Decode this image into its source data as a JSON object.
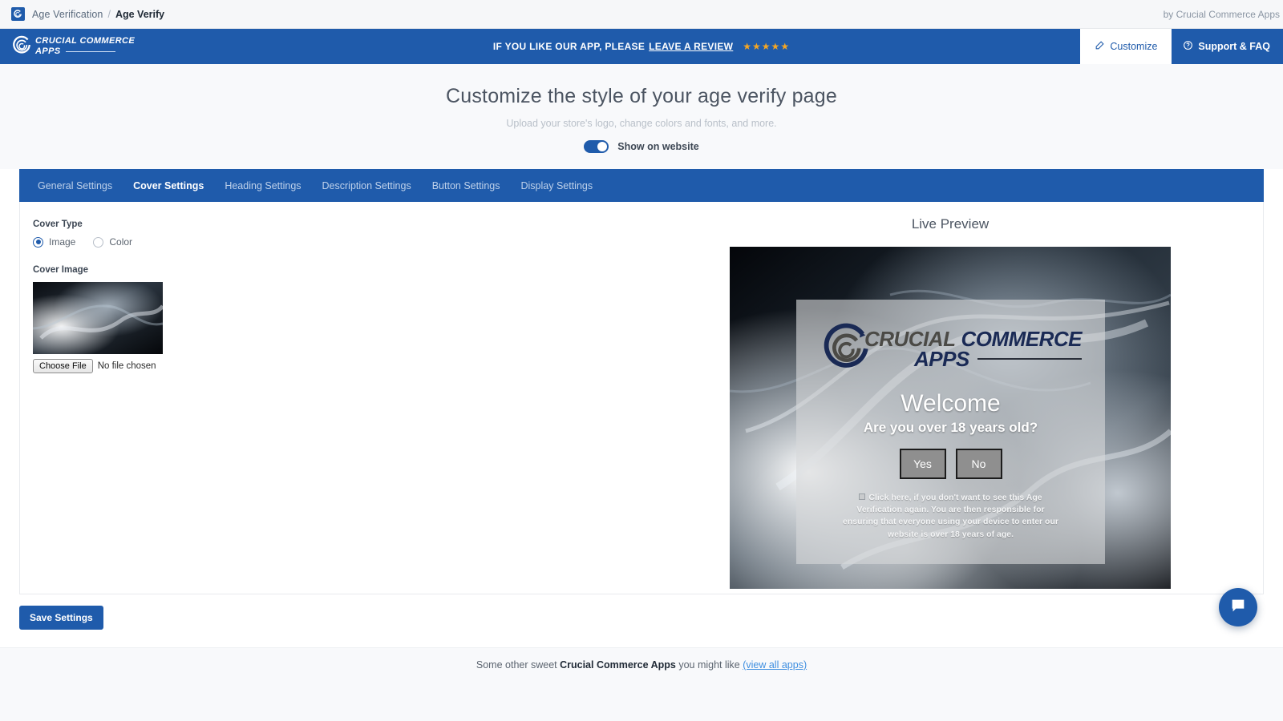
{
  "breadcrumb": {
    "app_icon": "app-logo-icon",
    "parent": "Age Verification",
    "separator": "/",
    "current": "Age Verify",
    "by_line": "by Crucial Commerce Apps"
  },
  "topnav": {
    "brand_line1": "CRUCIAL COMMERCE",
    "brand_line2": "APPS",
    "review_text": "IF YOU LIKE OUR APP, PLEASE",
    "review_link": "LEAVE A REVIEW",
    "stars": "★★★★★",
    "customize_label": "Customize",
    "support_label": "Support & FAQ",
    "accent_color": "#1f5bab",
    "star_color": "#f5a623"
  },
  "hero": {
    "title": "Customize the style of your age verify page",
    "subtitle": "Upload your store's logo, change colors and fonts, and more.",
    "toggle_label": "Show on website",
    "toggle_on": "true"
  },
  "tabs": [
    {
      "label": "General Settings",
      "active": "false"
    },
    {
      "label": "Cover Settings",
      "active": "true"
    },
    {
      "label": "Heading Settings",
      "active": "false"
    },
    {
      "label": "Description Settings",
      "active": "false"
    },
    {
      "label": "Button Settings",
      "active": "false"
    },
    {
      "label": "Display Settings",
      "active": "false"
    }
  ],
  "form": {
    "cover_type_label": "Cover Type",
    "cover_type_options": [
      {
        "label": "Image",
        "selected": "true"
      },
      {
        "label": "Color",
        "selected": "false"
      }
    ],
    "cover_image_label": "Cover Image",
    "file_button_label": "Choose File",
    "file_status": "No file chosen"
  },
  "preview": {
    "title": "Live Preview",
    "logo_crucial": "CRUCIAL",
    "logo_commerce": "COMMERCE",
    "logo_apps": "APPS",
    "heading": "Welcome",
    "question": "Are you over 18 years old?",
    "yes_label": "Yes",
    "no_label": "No",
    "disclaimer": "Click here, if you don't want to see this Age Verification again. You are then responsible for ensuring that everyone using your device to enter our website is over 18 years of age.",
    "button_bg": "#8f8f8f",
    "overlay_color": "rgba(215,216,218,0.62)"
  },
  "actions": {
    "save_label": "Save Settings"
  },
  "footer": {
    "text_before": "Some other sweet ",
    "brand": "Crucial Commerce Apps",
    "text_after": " you might like ",
    "link": "(view all apps)"
  },
  "chat": {
    "icon": "chat-bubble-icon"
  }
}
